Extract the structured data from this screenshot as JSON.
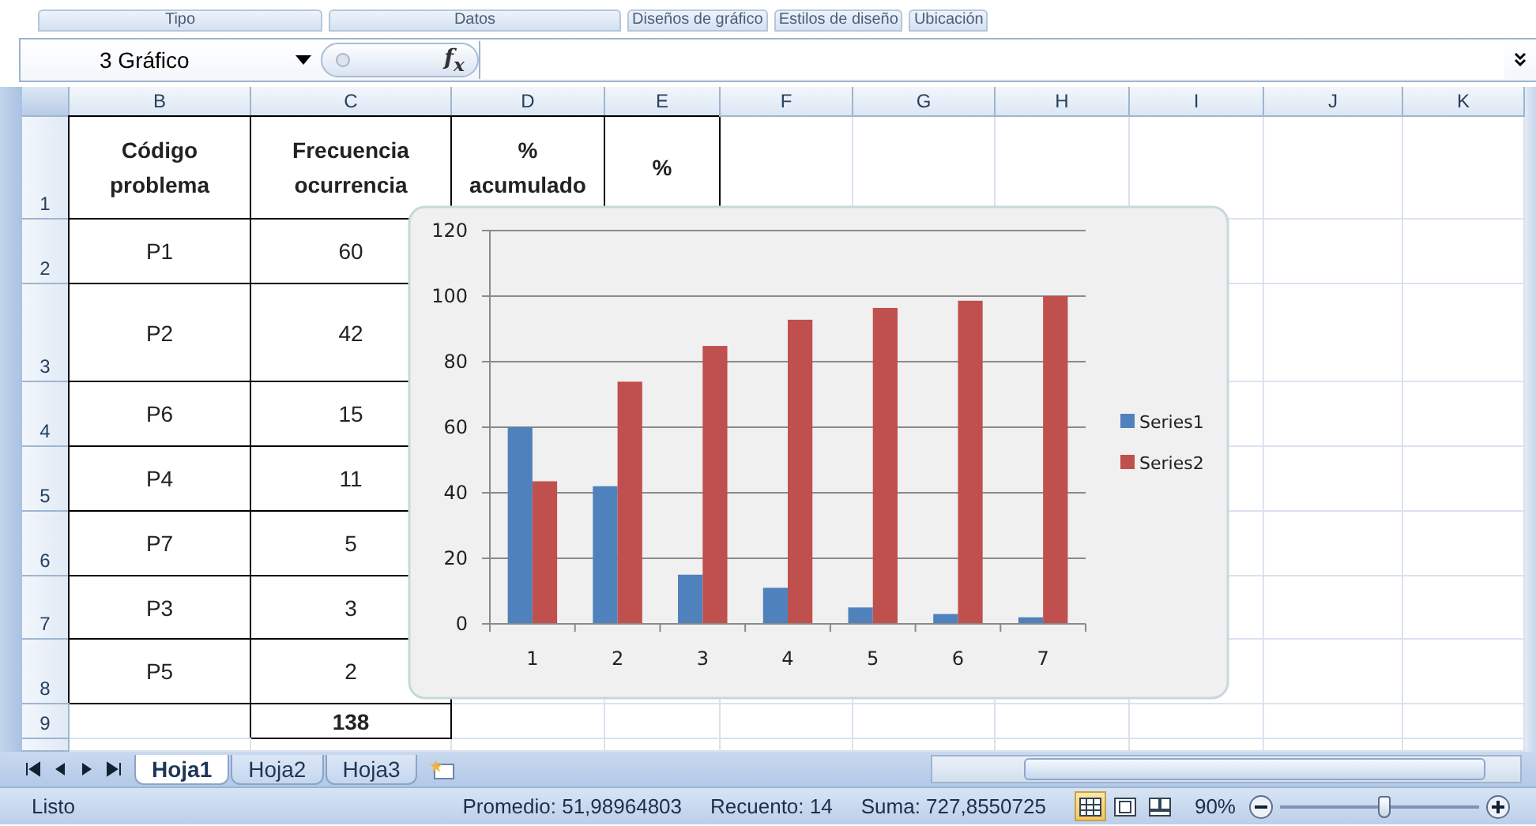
{
  "ribbon_groups": [
    "Tipo",
    "Datos",
    "Diseños de gráfico",
    "Estilos de diseño",
    "Ubicación"
  ],
  "formula_bar": {
    "name_box": "3 Gráfico",
    "function_label": "f$_{x}$"
  },
  "columns": [
    "B",
    "C",
    "D",
    "E",
    "F",
    "G",
    "H",
    "I",
    "J",
    "K"
  ],
  "rows": [
    {
      "header": "1",
      "kind": "header",
      "cells": {
        "B": "Código problema",
        "C": "Frecuencia ocurrencia",
        "D": "% acumulado",
        "E": "%"
      }
    },
    {
      "header": "2",
      "kind": "data",
      "cells": {
        "B": "P1",
        "C": "60"
      }
    },
    {
      "header": "3",
      "kind": "data",
      "cells": {
        "B": "P2",
        "C": "42"
      }
    },
    {
      "header": "4",
      "kind": "data",
      "cells": {
        "B": "P6",
        "C": "15"
      }
    },
    {
      "header": "5",
      "kind": "data",
      "cells": {
        "B": "P4",
        "C": "11"
      }
    },
    {
      "header": "6",
      "kind": "data",
      "cells": {
        "B": "P7",
        "C": "5"
      }
    },
    {
      "header": "7",
      "kind": "data",
      "cells": {
        "B": "P3",
        "C": "3"
      }
    },
    {
      "header": "8",
      "kind": "data",
      "cells": {
        "B": "P5",
        "C": "2"
      }
    },
    {
      "header": "9",
      "kind": "total",
      "cells": {
        "C": "138"
      }
    }
  ],
  "chart": {
    "chart_data": {
      "type": "bar",
      "categories": [
        "1",
        "2",
        "3",
        "4",
        "5",
        "6",
        "7"
      ],
      "series": [
        {
          "name": "Series1",
          "color": "#4f81bd",
          "values": [
            60,
            42,
            15,
            11,
            5,
            3,
            2
          ]
        },
        {
          "name": "Series2",
          "color": "#c0504d",
          "values": [
            43.5,
            73.9,
            84.8,
            92.8,
            96.4,
            98.6,
            100
          ]
        }
      ],
      "ylim": [
        0,
        120
      ],
      "yticks": [
        {
          "value": 0,
          "label": "0"
        },
        {
          "value": 20,
          "label": "20"
        },
        {
          "value": 40,
          "label": "40"
        },
        {
          "value": 60,
          "label": "60"
        },
        {
          "value": 80,
          "label": "80"
        },
        {
          "value": 100,
          "label": "100"
        },
        {
          "value": 120,
          "label": "120"
        }
      ],
      "grid": true,
      "legend": "right"
    }
  },
  "sheet_tabs": [
    {
      "label": "Hoja1",
      "selected": true
    },
    {
      "label": "Hoja2",
      "selected": false
    },
    {
      "label": "Hoja3",
      "selected": false
    }
  ],
  "status_bar": {
    "mode": "Listo",
    "items": [
      "Promedio: 51,98964803",
      "Recuento: 14",
      "Suma: 727,8550725"
    ],
    "views": [
      {
        "kind": "normal",
        "selected": true
      },
      {
        "kind": "page_layout",
        "selected": false
      },
      {
        "kind": "page_break",
        "selected": false
      }
    ],
    "zoom": {
      "label": "90%",
      "level": 0.52
    }
  }
}
